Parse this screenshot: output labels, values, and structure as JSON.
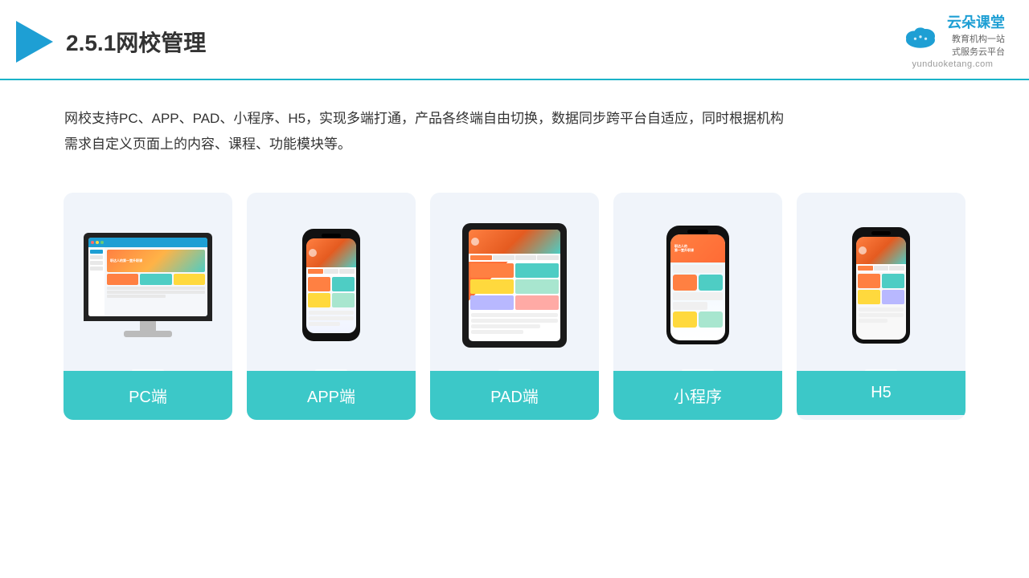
{
  "header": {
    "title": "2.5.1网校管理",
    "brand_name": "云朵课堂",
    "brand_url": "yunduoketang.com",
    "brand_tagline": "教育机构一站\n式服务云平台"
  },
  "description": {
    "text": "网校支持PC、APP、PAD、小程序、H5，实现多端打通，产品各终端自由切换，数据同步跨平台自适应，同时根据机构需求自定义页面上的内容、课程、功能模块等。"
  },
  "cards": [
    {
      "id": "pc",
      "label": "PC端"
    },
    {
      "id": "app",
      "label": "APP端"
    },
    {
      "id": "pad",
      "label": "PAD端"
    },
    {
      "id": "mini",
      "label": "小程序"
    },
    {
      "id": "h5",
      "label": "H5"
    }
  ]
}
